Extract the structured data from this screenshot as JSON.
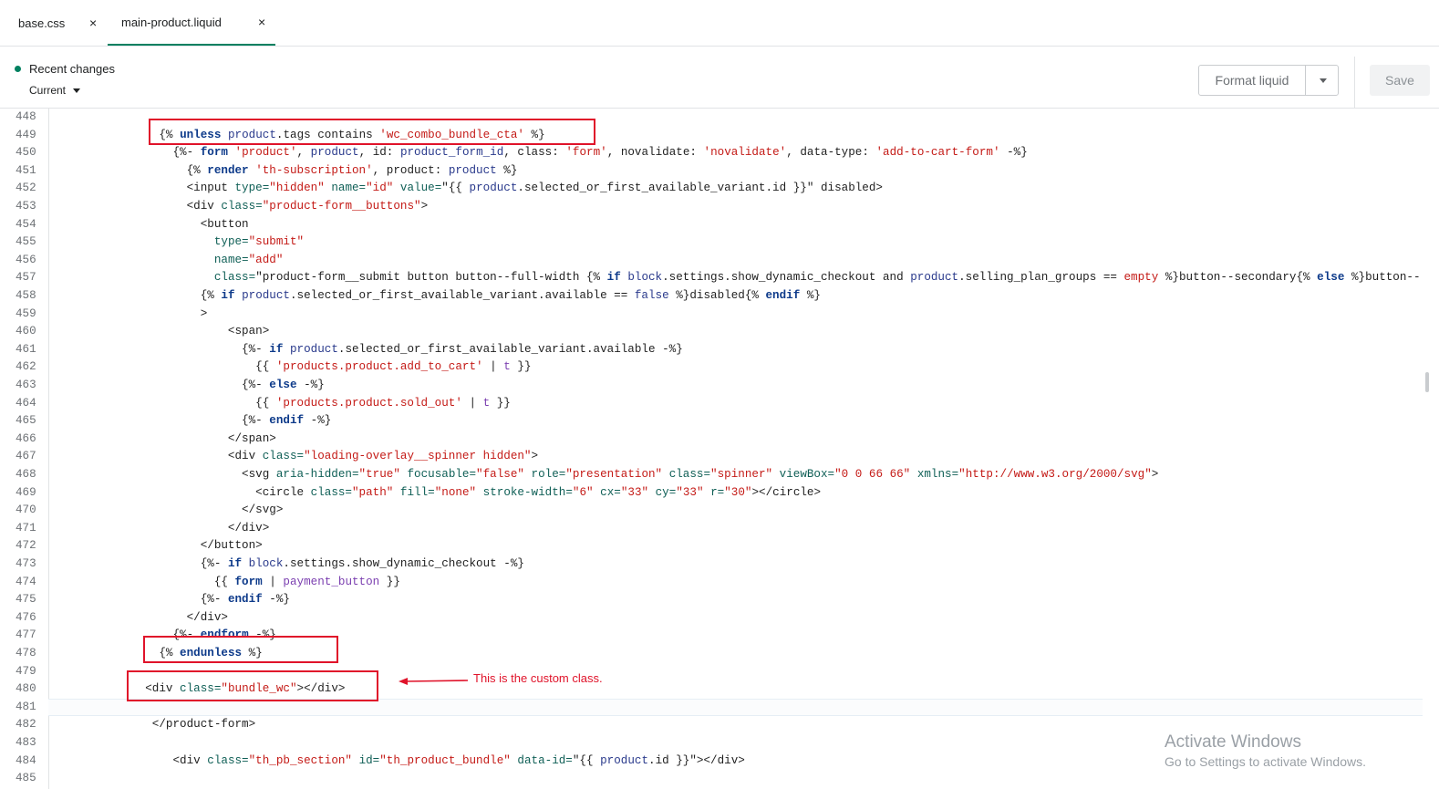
{
  "tabs": [
    {
      "label": "base.css",
      "close": "×"
    },
    {
      "label": "main-product.liquid",
      "close": "×"
    }
  ],
  "header": {
    "recent_changes": "Recent changes",
    "current": "Current",
    "format_label": "Format liquid",
    "save_label": "Save"
  },
  "accent_color": "#008060",
  "annotation": {
    "text": "This is the custom class.",
    "color": "#e0132a"
  },
  "watermark": {
    "title": "Activate Windows",
    "subtitle": "Go to Settings to activate Windows."
  },
  "highlighted_line": 481,
  "code_lines": [
    {
      "n": "448",
      "t": []
    },
    {
      "n": "449",
      "t": [
        [
          "               ",
          ""
        ],
        [
          "{% ",
          ""
        ],
        [
          "unless",
          "k"
        ],
        [
          " ",
          ""
        ],
        [
          "product",
          "v"
        ],
        [
          ".tags contains ",
          ""
        ],
        [
          "'wc_combo_bundle_cta'",
          "s"
        ],
        [
          " %}",
          ""
        ]
      ]
    },
    {
      "n": "450",
      "t": [
        [
          "                 {%- ",
          ""
        ],
        [
          "form",
          "k"
        ],
        [
          " ",
          ""
        ],
        [
          "'product'",
          "s"
        ],
        [
          ", ",
          ""
        ],
        [
          "product",
          "v"
        ],
        [
          ", id: ",
          ""
        ],
        [
          "product_form_id",
          "v"
        ],
        [
          ", class: ",
          ""
        ],
        [
          "'form'",
          "s"
        ],
        [
          ", novalidate: ",
          ""
        ],
        [
          "'novalidate'",
          "s"
        ],
        [
          ", data-type: ",
          ""
        ],
        [
          "'add-to-cart-form'",
          "s"
        ],
        [
          " -%}",
          ""
        ]
      ]
    },
    {
      "n": "451",
      "t": [
        [
          "                   {% ",
          ""
        ],
        [
          "render",
          "k"
        ],
        [
          " ",
          ""
        ],
        [
          "'th-subscription'",
          "s"
        ],
        [
          ", product: ",
          ""
        ],
        [
          "product",
          "v"
        ],
        [
          " %}",
          ""
        ]
      ]
    },
    {
      "n": "452",
      "t": [
        [
          "                   <input ",
          ""
        ],
        [
          "type=",
          "a"
        ],
        [
          "\"hidden\"",
          "s"
        ],
        [
          " ",
          ""
        ],
        [
          "name=",
          "a"
        ],
        [
          "\"id\"",
          "s"
        ],
        [
          " ",
          ""
        ],
        [
          "value=",
          "a"
        ],
        [
          "\"{{ ",
          ""
        ],
        [
          "product",
          "v"
        ],
        [
          ".selected_or_first_available_variant.id }}\"",
          ""
        ],
        [
          " disabled>",
          ""
        ]
      ]
    },
    {
      "n": "453",
      "t": [
        [
          "                   <div ",
          ""
        ],
        [
          "class=",
          "a"
        ],
        [
          "\"product-form__buttons\"",
          "s"
        ],
        [
          ">",
          ""
        ]
      ]
    },
    {
      "n": "454",
      "t": [
        [
          "                     <button",
          ""
        ]
      ]
    },
    {
      "n": "455",
      "t": [
        [
          "                       ",
          ""
        ],
        [
          "type=",
          "a"
        ],
        [
          "\"submit\"",
          "s"
        ]
      ]
    },
    {
      "n": "456",
      "t": [
        [
          "                       ",
          ""
        ],
        [
          "name=",
          "a"
        ],
        [
          "\"add\"",
          "s"
        ]
      ]
    },
    {
      "n": "457",
      "t": [
        [
          "                       ",
          ""
        ],
        [
          "class=",
          "a"
        ],
        [
          "\"product-form__submit button button--full-width ",
          ""
        ],
        [
          "{% ",
          ""
        ],
        [
          "if",
          "k"
        ],
        [
          " ",
          ""
        ],
        [
          "block",
          "v"
        ],
        [
          ".settings.show_dynamic_checkout and ",
          ""
        ],
        [
          "product",
          "v"
        ],
        [
          ".selling_plan_groups == ",
          ""
        ],
        [
          "empty",
          "s"
        ],
        [
          " %}",
          ""
        ],
        [
          "button--secondary",
          ""
        ],
        [
          "{% ",
          ""
        ],
        [
          "else",
          "k"
        ],
        [
          " %}",
          ""
        ],
        [
          "button--",
          ""
        ]
      ]
    },
    {
      "n": "458",
      "t": [
        [
          "                     {% ",
          ""
        ],
        [
          "if",
          "k"
        ],
        [
          " ",
          ""
        ],
        [
          "product",
          "v"
        ],
        [
          ".selected_or_first_available_variant.available == ",
          ""
        ],
        [
          "false",
          "v"
        ],
        [
          " %}",
          ""
        ],
        [
          "disabled",
          ""
        ],
        [
          "{% ",
          ""
        ],
        [
          "endif",
          "k"
        ],
        [
          " %}",
          ""
        ]
      ]
    },
    {
      "n": "459",
      "t": [
        [
          "                     >",
          ""
        ]
      ]
    },
    {
      "n": "460",
      "t": [
        [
          "                         <span>",
          ""
        ]
      ]
    },
    {
      "n": "461",
      "t": [
        [
          "                           {%- ",
          ""
        ],
        [
          "if",
          "k"
        ],
        [
          " ",
          ""
        ],
        [
          "product",
          "v"
        ],
        [
          ".selected_or_first_available_variant.available -%}",
          ""
        ]
      ]
    },
    {
      "n": "462",
      "t": [
        [
          "                             {{ ",
          ""
        ],
        [
          "'products.product.add_to_cart'",
          "s"
        ],
        [
          " | ",
          ""
        ],
        [
          "t",
          "f"
        ],
        [
          " }}",
          ""
        ]
      ]
    },
    {
      "n": "463",
      "t": [
        [
          "                           {%- ",
          ""
        ],
        [
          "else",
          "k"
        ],
        [
          " -%}",
          ""
        ]
      ]
    },
    {
      "n": "464",
      "t": [
        [
          "                             {{ ",
          ""
        ],
        [
          "'products.product.sold_out'",
          "s"
        ],
        [
          " | ",
          ""
        ],
        [
          "t",
          "f"
        ],
        [
          " }}",
          ""
        ]
      ]
    },
    {
      "n": "465",
      "t": [
        [
          "                           {%- ",
          ""
        ],
        [
          "endif",
          "k"
        ],
        [
          " -%}",
          ""
        ]
      ]
    },
    {
      "n": "466",
      "t": [
        [
          "                         </span>",
          ""
        ]
      ]
    },
    {
      "n": "467",
      "t": [
        [
          "                         <div ",
          ""
        ],
        [
          "class=",
          "a"
        ],
        [
          "\"loading-overlay__spinner hidden\"",
          "s"
        ],
        [
          ">",
          ""
        ]
      ]
    },
    {
      "n": "468",
      "t": [
        [
          "                           <svg ",
          ""
        ],
        [
          "aria-hidden=",
          "a"
        ],
        [
          "\"true\"",
          "s"
        ],
        [
          " ",
          ""
        ],
        [
          "focusable=",
          "a"
        ],
        [
          "\"false\"",
          "s"
        ],
        [
          " ",
          ""
        ],
        [
          "role=",
          "a"
        ],
        [
          "\"presentation\"",
          "s"
        ],
        [
          " ",
          ""
        ],
        [
          "class=",
          "a"
        ],
        [
          "\"spinner\"",
          "s"
        ],
        [
          " ",
          ""
        ],
        [
          "viewBox=",
          "a"
        ],
        [
          "\"0 0 66 66\"",
          "s"
        ],
        [
          " ",
          ""
        ],
        [
          "xmlns=",
          "a"
        ],
        [
          "\"http://www.w3.org/2000/svg\"",
          "s"
        ],
        [
          ">",
          ""
        ]
      ]
    },
    {
      "n": "469",
      "t": [
        [
          "                             <circle ",
          ""
        ],
        [
          "class=",
          "a"
        ],
        [
          "\"path\"",
          "s"
        ],
        [
          " ",
          ""
        ],
        [
          "fill=",
          "a"
        ],
        [
          "\"none\"",
          "s"
        ],
        [
          " ",
          ""
        ],
        [
          "stroke-width=",
          "a"
        ],
        [
          "\"6\"",
          "s"
        ],
        [
          " ",
          ""
        ],
        [
          "cx=",
          "a"
        ],
        [
          "\"33\"",
          "s"
        ],
        [
          " ",
          ""
        ],
        [
          "cy=",
          "a"
        ],
        [
          "\"33\"",
          "s"
        ],
        [
          " ",
          ""
        ],
        [
          "r=",
          "a"
        ],
        [
          "\"30\"",
          "s"
        ],
        [
          "></circle>",
          ""
        ]
      ]
    },
    {
      "n": "470",
      "t": [
        [
          "                           </svg>",
          ""
        ]
      ]
    },
    {
      "n": "471",
      "t": [
        [
          "                         </div>",
          ""
        ]
      ]
    },
    {
      "n": "472",
      "t": [
        [
          "                     </button>",
          ""
        ]
      ]
    },
    {
      "n": "473",
      "t": [
        [
          "                     {%- ",
          ""
        ],
        [
          "if",
          "k"
        ],
        [
          " ",
          ""
        ],
        [
          "block",
          "v"
        ],
        [
          ".settings.show_dynamic_checkout -%}",
          ""
        ]
      ]
    },
    {
      "n": "474",
      "t": [
        [
          "                       {{ ",
          ""
        ],
        [
          "form",
          "k"
        ],
        [
          " | ",
          ""
        ],
        [
          "payment_button",
          "f"
        ],
        [
          " }}",
          ""
        ]
      ]
    },
    {
      "n": "475",
      "t": [
        [
          "                     {%- ",
          ""
        ],
        [
          "endif",
          "k"
        ],
        [
          " -%}",
          ""
        ]
      ]
    },
    {
      "n": "476",
      "t": [
        [
          "                   </div>",
          ""
        ]
      ]
    },
    {
      "n": "477",
      "t": [
        [
          "                 {%- ",
          ""
        ],
        [
          "endform",
          "k"
        ],
        [
          " -%}",
          ""
        ]
      ]
    },
    {
      "n": "478",
      "t": [
        [
          "               {% ",
          ""
        ],
        [
          "endunless",
          "k"
        ],
        [
          " %}",
          ""
        ]
      ]
    },
    {
      "n": "479",
      "t": []
    },
    {
      "n": "480",
      "t": [
        [
          "             <div ",
          ""
        ],
        [
          "class=",
          "a"
        ],
        [
          "\"bundle_wc\"",
          "s"
        ],
        [
          "></div>",
          ""
        ]
      ]
    },
    {
      "n": "481",
      "t": []
    },
    {
      "n": "482",
      "t": [
        [
          "              </product-form>",
          ""
        ]
      ]
    },
    {
      "n": "483",
      "t": []
    },
    {
      "n": "484",
      "t": [
        [
          "                 <div ",
          ""
        ],
        [
          "class=",
          "a"
        ],
        [
          "\"th_pb_section\"",
          "s"
        ],
        [
          " ",
          ""
        ],
        [
          "id=",
          "a"
        ],
        [
          "\"th_product_bundle\"",
          "s"
        ],
        [
          " ",
          ""
        ],
        [
          "data-id=",
          "a"
        ],
        [
          "\"{{ ",
          ""
        ],
        [
          "product",
          "v"
        ],
        [
          ".id }}\"",
          ""
        ],
        [
          "></div>",
          ""
        ]
      ]
    },
    {
      "n": "485",
      "t": []
    }
  ]
}
